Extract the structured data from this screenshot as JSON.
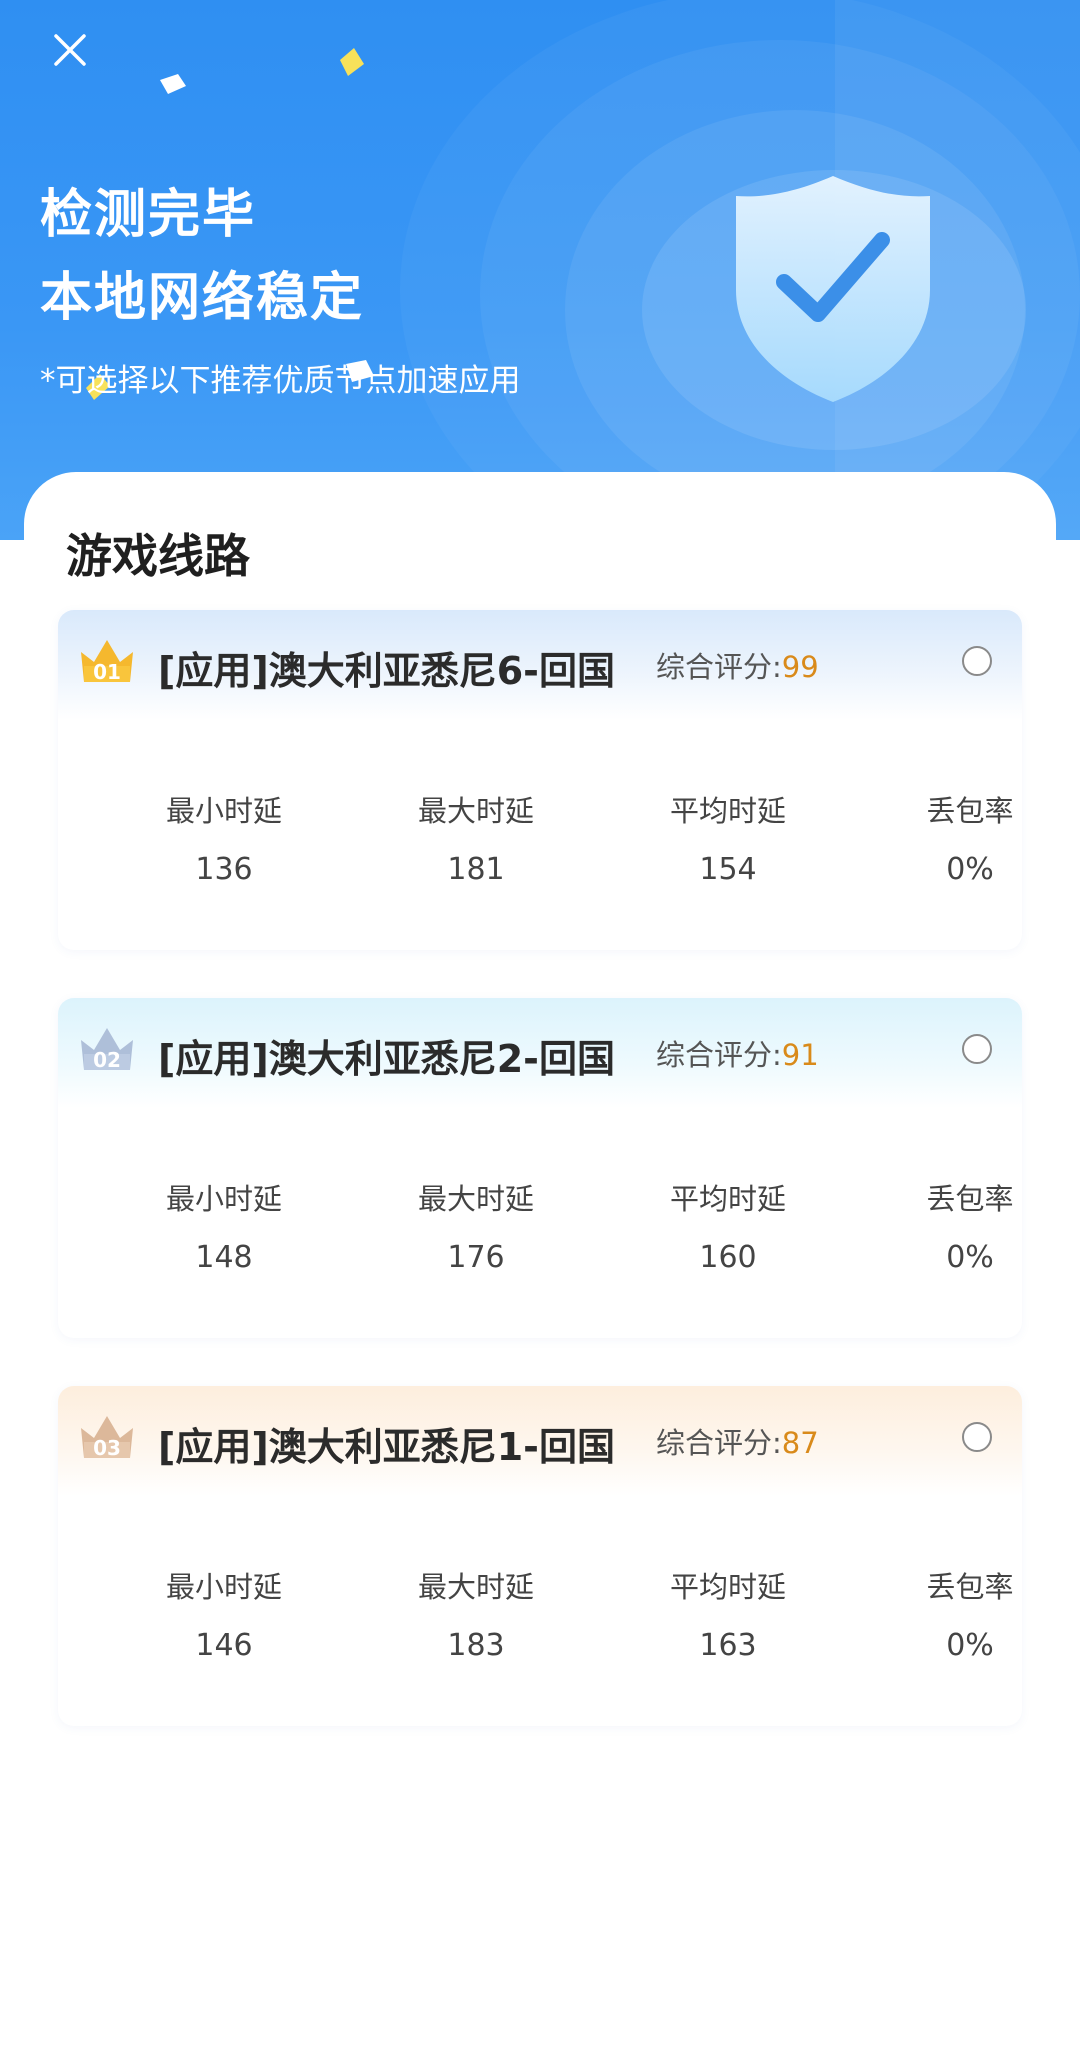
{
  "header": {
    "close_icon": "close-icon",
    "title_line1": "检测完毕",
    "title_line2": "本地网络稳定",
    "subtitle": "*可选择以下推荐优质节点加速应用",
    "shield_icon": "shield-check-icon",
    "colors": {
      "background": "#3a97f5",
      "text": "#ffffff"
    }
  },
  "section": {
    "title": "游戏线路"
  },
  "stat_labels": {
    "min": "最小时延",
    "max": "最大时延",
    "avg": "平均时延",
    "loss": "丢包率"
  },
  "routes": [
    {
      "rank": "01",
      "rank_icon": "gold-crown-icon",
      "name": "[应用]澳大利亚悉尼6-回国",
      "score_label": "综合评分:",
      "score": "99",
      "selected": false,
      "min": "136",
      "max": "181",
      "avg": "154",
      "loss": "0%"
    },
    {
      "rank": "02",
      "rank_icon": "silver-crown-icon",
      "name": "[应用]澳大利亚悉尼2-回国",
      "score_label": "综合评分:",
      "score": "91",
      "selected": false,
      "min": "148",
      "max": "176",
      "avg": "160",
      "loss": "0%"
    },
    {
      "rank": "03",
      "rank_icon": "bronze-crown-icon",
      "name": "[应用]澳大利亚悉尼1-回国",
      "score_label": "综合评分:",
      "score": "87",
      "selected": false,
      "min": "146",
      "max": "183",
      "avg": "163",
      "loss": "0%"
    }
  ],
  "colors": {
    "accent": "#3a97f5",
    "score": "#d98a1a",
    "gold": "#f5b82e",
    "silver": "#aebfd9",
    "bronze": "#dcb89a"
  }
}
